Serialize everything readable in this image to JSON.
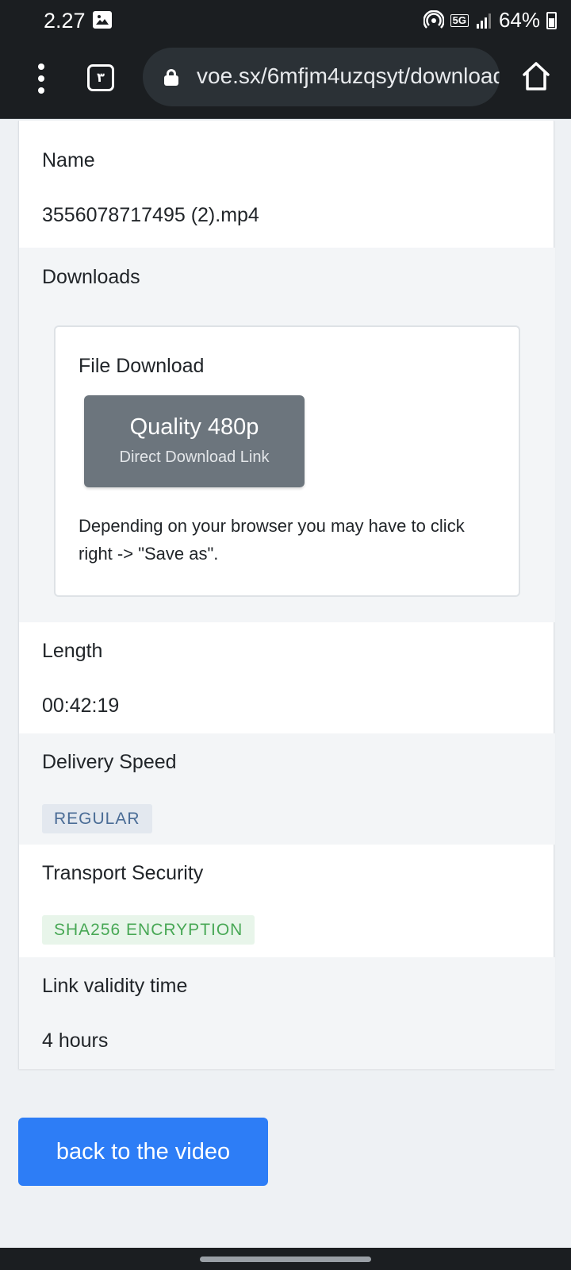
{
  "status_bar": {
    "time": "2.27",
    "battery": "64%",
    "network": "5G"
  },
  "browser": {
    "url": "voe.sx/6mfjm4uzqsyt/download",
    "tab_count": "٣"
  },
  "file_info": {
    "name_label": "Name",
    "name_value": "3556078717495 (2).mp4",
    "downloads_label": "Downloads",
    "download_box": {
      "title": "File Download",
      "button_quality": "Quality 480p",
      "button_sub": "Direct Download Link",
      "note": "Depending on your browser you may have to click right -> \"Save as\"."
    },
    "length_label": "Length",
    "length_value": "00:42:19",
    "speed_label": "Delivery Speed",
    "speed_value": "REGULAR",
    "security_label": "Transport Security",
    "security_value": "SHA256 ENCRYPTION",
    "validity_label": "Link validity time",
    "validity_value": "4 hours"
  },
  "back_button": "back to the video",
  "colors": {
    "primary_button": "#2d7df6",
    "secondary_button": "#6c757d",
    "regular_badge_text": "#4a6c96",
    "sha_badge_text": "#48a855"
  },
  "icons": [
    "gallery-icon",
    "hotspot-icon",
    "5g-icon",
    "signal-icon",
    "battery-icon",
    "menu-dots-icon",
    "tab-switcher-icon",
    "lock-icon",
    "home-icon"
  ]
}
